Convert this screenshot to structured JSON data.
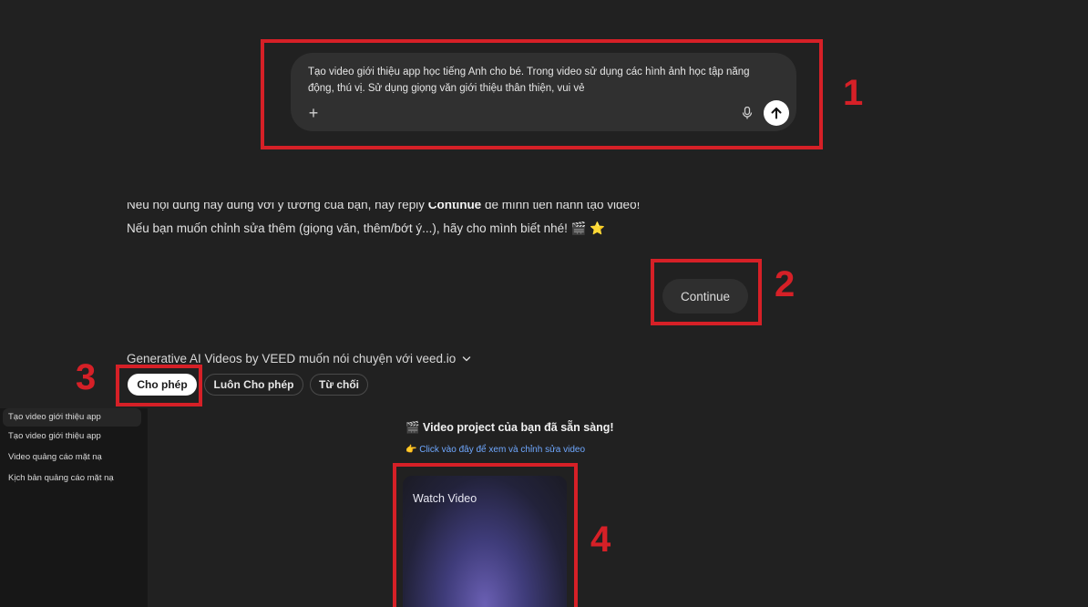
{
  "composer": {
    "text": "Tạo video giới thiệu app học tiếng Anh cho bé. Trong video sử dụng các hình ảnh học tập năng động, thú vị. Sử dụng giọng văn giới thiệu thân thiện, vui vẻ",
    "plus_label": "+"
  },
  "markers": {
    "m1": "1",
    "m2": "2",
    "m3": "3",
    "m4": "4"
  },
  "message": {
    "line1_pre": "Nếu nội dung này đúng với ý tưởng của bạn, hãy reply ",
    "line1_bold": "Continue",
    "line1_post": " để mình tiến hành tạo video!",
    "line2": "Nếu bạn muốn chỉnh sửa thêm (giọng văn, thêm/bớt ý...), hãy cho mình biết nhé! 🎬 ⭐",
    "continue_label": "Continue"
  },
  "permission": {
    "title": "Generative AI Videos by VEED muốn nói chuyện với veed.io",
    "allow": "Cho phép",
    "always_allow": "Luôn Cho phép",
    "deny": "Từ chối"
  },
  "sidebar": {
    "items": [
      {
        "label": "Tạo video giới thiệu app",
        "active": true
      },
      {
        "label": "Tạo video giới thiệu app",
        "active": false
      },
      {
        "label": "Video quảng cáo mặt nạ",
        "active": false
      },
      {
        "label": "Kịch bản quảng cáo mặt nạ",
        "active": false
      }
    ]
  },
  "result": {
    "ready": "🎬 Video project của bạn đã sẵn sàng!",
    "link": "👉 Click vào đây để xem và chỉnh sửa video",
    "watch_label": "Watch Video"
  },
  "colors": {
    "accent_red": "#d62027",
    "link_blue": "#6fa8ff",
    "bg": "#212121"
  }
}
